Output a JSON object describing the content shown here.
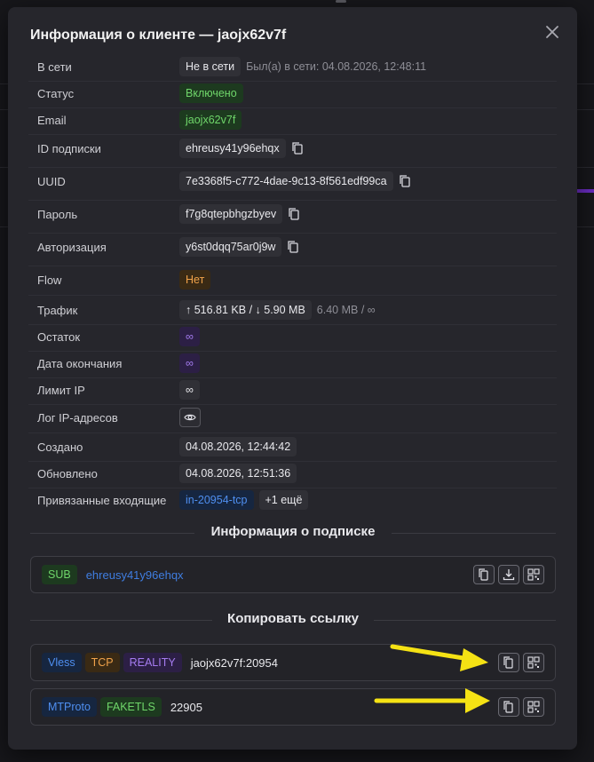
{
  "modal": {
    "title": "Информация о клиенте — jaojx62v7f"
  },
  "rows": {
    "online": {
      "label": "В сети",
      "status": "Не в сети",
      "last_seen": "Был(а) в сети: 04.08.2026, 12:48:11"
    },
    "status": {
      "label": "Статус",
      "value": "Включено"
    },
    "email": {
      "label": "Email",
      "value": "jaojx62v7f"
    },
    "sub_id": {
      "label": "ID подписки",
      "value": "ehreusy41y96ehqx"
    },
    "uuid": {
      "label": "UUID",
      "value": "7e3368f5-c772-4dae-9c13-8f561edf99ca"
    },
    "password": {
      "label": "Пароль",
      "value": "f7g8qtepbhgzbyev"
    },
    "auth": {
      "label": "Авторизация",
      "value": "y6st0dqq75ar0j9w"
    },
    "flow": {
      "label": "Flow",
      "value": "Нет"
    },
    "traffic": {
      "label": "Трафик",
      "value": "↑ 516.81 KB / ↓ 5.90 MB",
      "total": "6.40 MB / ∞"
    },
    "remaining": {
      "label": "Остаток",
      "value": "∞"
    },
    "expiry": {
      "label": "Дата окончания",
      "value": "∞"
    },
    "ip_limit": {
      "label": "Лимит IP",
      "value": "∞"
    },
    "ip_log": {
      "label": "Лог IP-адресов"
    },
    "created": {
      "label": "Создано",
      "value": "04.08.2026, 12:44:42"
    },
    "updated": {
      "label": "Обновлено",
      "value": "04.08.2026, 12:51:36"
    },
    "inbounds": {
      "label": "Привязанные входящие",
      "value": "in-20954-tcp",
      "more": "+1 ещё"
    }
  },
  "subscription": {
    "heading": "Информация о подписке",
    "tag": "SUB",
    "link": "ehreusy41y96ehqx"
  },
  "copy_links": {
    "heading": "Копировать ссылку",
    "items": [
      {
        "tags": [
          "Vless",
          "TCP",
          "REALITY"
        ],
        "text": "jaojx62v7f:20954"
      },
      {
        "tags": [
          "MTProto",
          "FAKETLS"
        ],
        "text": "22905"
      }
    ]
  },
  "colors": {
    "modal_bg": "#26262c",
    "green": "#6fd66a",
    "orange": "#f0a24a",
    "purple": "#a57cf0",
    "blue": "#4f8ff0",
    "arrow": "#f5e214"
  }
}
